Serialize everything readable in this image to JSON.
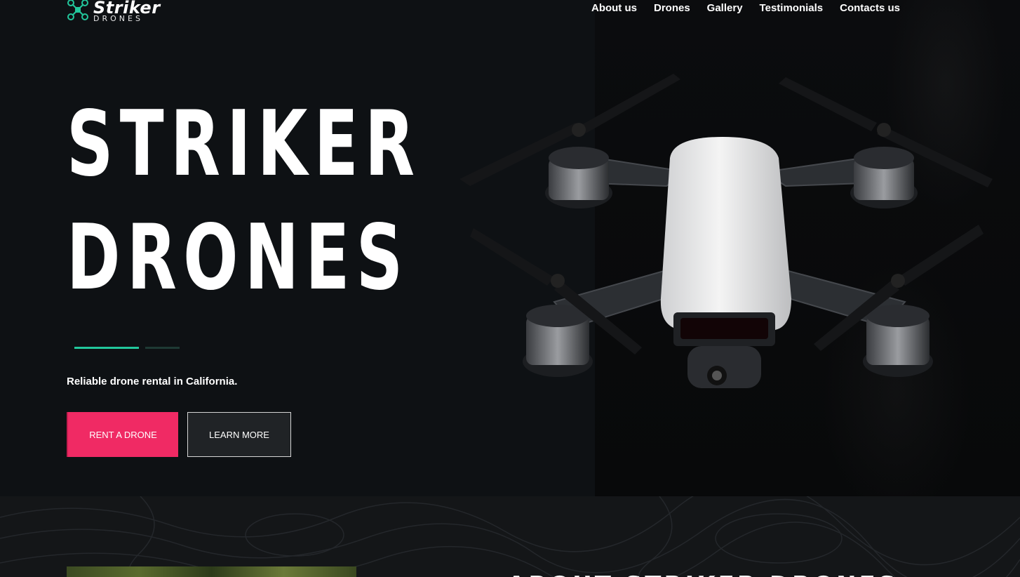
{
  "brand": {
    "name": "Striker",
    "sub": "DRONES",
    "accent": "#22c79c",
    "primary": "#f02a64"
  },
  "nav": {
    "items": [
      {
        "label": "About us"
      },
      {
        "label": "Drones"
      },
      {
        "label": "Gallery"
      },
      {
        "label": "Testimonials"
      },
      {
        "label": "Contacts us"
      }
    ]
  },
  "hero": {
    "title_line1": "STRIKER",
    "title_line2": "DRONES",
    "tagline": "Reliable drone rental in California.",
    "primary_button": "RENT A DRONE",
    "secondary_button": "LEARN MORE"
  },
  "about": {
    "heading": "ABOUT STRIKER DRONES"
  }
}
